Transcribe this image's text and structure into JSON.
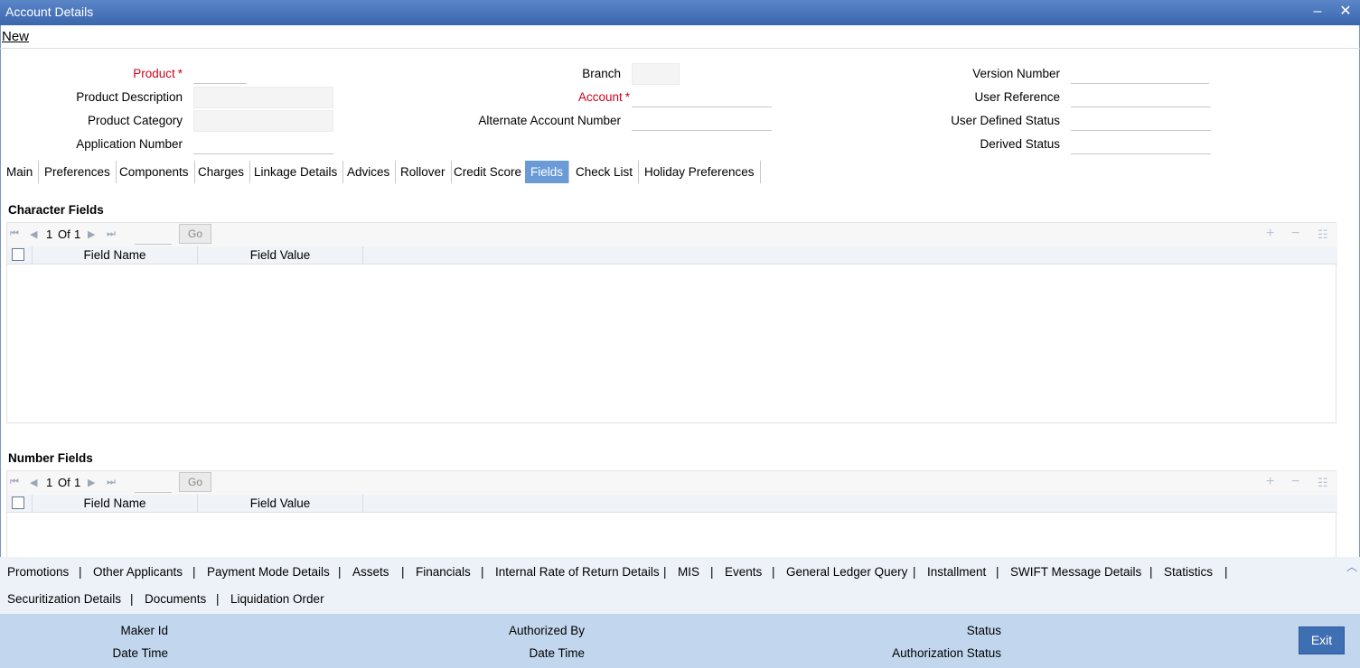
{
  "window": {
    "title": "Account Details",
    "minimize_glyph": "‒",
    "close_glyph": "✕"
  },
  "menu": {
    "new_label": "New"
  },
  "form": {
    "product_label": "Product",
    "product_description_label": "Product Description",
    "product_category_label": "Product Category",
    "application_number_label": "Application Number",
    "branch_label": "Branch",
    "account_label": "Account",
    "alternate_account_label": "Alternate Account Number",
    "version_number_label": "Version Number",
    "user_reference_label": "User Reference",
    "user_defined_status_label": "User Defined Status",
    "derived_status_label": "Derived Status",
    "required_mark": "*"
  },
  "tabs": [
    {
      "label": "Main"
    },
    {
      "label": "Preferences"
    },
    {
      "label": "Components"
    },
    {
      "label": "Charges"
    },
    {
      "label": "Linkage Details"
    },
    {
      "label": "Advices"
    },
    {
      "label": "Rollover"
    },
    {
      "label": "Credit Score"
    },
    {
      "label": "Fields"
    },
    {
      "label": "Check List"
    },
    {
      "label": "Holiday Preferences"
    }
  ],
  "active_tab": "Fields",
  "character_fields": {
    "title": "Character Fields",
    "page_current": "1",
    "page_of": "Of",
    "page_total": "1",
    "go_label": "Go",
    "col_field_name": "Field Name",
    "col_field_value": "Field Value"
  },
  "number_fields": {
    "title": "Number Fields",
    "page_current": "1",
    "page_of": "Of",
    "page_total": "1",
    "go_label": "Go",
    "col_field_name": "Field Name",
    "col_field_value": "Field Value"
  },
  "links": [
    "Promotions",
    "Other Applicants",
    "Payment Mode Details",
    "Assets",
    "Financials",
    "Internal Rate of Return Details",
    "MIS",
    "Events",
    "General Ledger Query",
    "Installment",
    "SWIFT Message Details",
    "Statistics",
    "Securitization Details",
    "Documents",
    "Liquidation Order"
  ],
  "link_separator": "|",
  "footer": {
    "maker_id_label": "Maker Id",
    "date_time_label_1": "Date Time",
    "authorized_by_label": "Authorized By",
    "date_time_label_2": "Date Time",
    "status_label": "Status",
    "authorization_status_label": "Authorization Status",
    "exit_label": "Exit"
  },
  "colors": {
    "titlebar": "#3a66ad",
    "active_tab": "#6a9bd7",
    "required": "#d0021b",
    "footer": "#c2d7ee",
    "exit_button": "#3f6fb3"
  }
}
